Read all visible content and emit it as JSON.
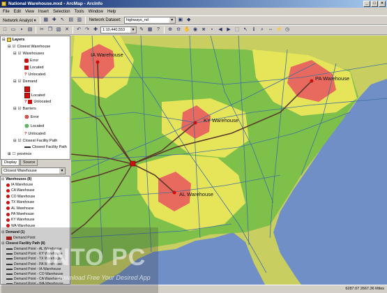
{
  "window": {
    "title": "National Warehouse.mxd - ArcMap - ArcInfo",
    "buttons": [
      "_",
      "□",
      "×"
    ]
  },
  "menu": [
    "File",
    "Edit",
    "View",
    "Insert",
    "Selection",
    "Tools",
    "Window",
    "Help"
  ],
  "toolbar1": {
    "network_analyst_label": "Network Analyst ▾",
    "network_dataset_label": "Network Dataset:",
    "network_dataset_value": "highways_nd"
  },
  "toolbar2": {
    "scale_value": "1:10,440,553"
  },
  "toc": {
    "root": "Layers",
    "closest_warehouse": "Closest Warehouse",
    "warehouses": "Warehouses",
    "error": "Error",
    "located": "Located",
    "unlocated": "Unlocated",
    "demand": "Demand",
    "demand_located": "Located",
    "demand_unlocated": "Unlocated",
    "barriers": "Barriers",
    "barriers_error": "Error",
    "barriers_located": "Located",
    "barriers_unlocated": "Unlocated",
    "closest_facility_path": "Closest Facility Path",
    "closest_facility_path_sub": "Closest Facility Path",
    "province": "province"
  },
  "tabs": [
    "Display",
    "Source"
  ],
  "na_window": {
    "combo_value": "Closest Warehouse",
    "warehouses_header": "Warehouses (8)",
    "warehouses": [
      "IA Warehouse",
      "CA Warehouse",
      "CO Warehouse",
      "TX Warehouse",
      "AL Warehouse",
      "PA Warehouse",
      "KY Warehouse",
      "WA Warehouse"
    ],
    "demand_header": "Demand (1)",
    "demand": [
      "Demand Point"
    ],
    "paths_header": "Closest Facility Path (8)",
    "paths": [
      "Demand Point - AL Warehouse",
      "Demand Point - KY Warehouse",
      "Demand Point - TX Warehouse",
      "Demand Point - PA Warehouse",
      "Demand Point - IA Warehouse",
      "Demand Point - CO Warehouse",
      "Demand Point - CA Warehouse",
      "Demand Point - WA Warehouse"
    ]
  },
  "map": {
    "labels": [
      "IA Warehouse",
      "PA Warehouse",
      "KY Warehouse",
      "AL Warehouse"
    ],
    "colors": {
      "ocean": "#6f8fc6",
      "land": "#c8cf60",
      "zone_green": "#7fc04a",
      "zone_yellow": "#e6e55a",
      "zone_red": "#e86a5e",
      "road": "#3f6fa0",
      "path": "#5a3a2a"
    }
  },
  "status": {
    "coords": "6287.07  2667.36 Miles"
  },
  "watermark": {
    "main": "INTO PC",
    "sub": "Download Free Your Desired App"
  }
}
